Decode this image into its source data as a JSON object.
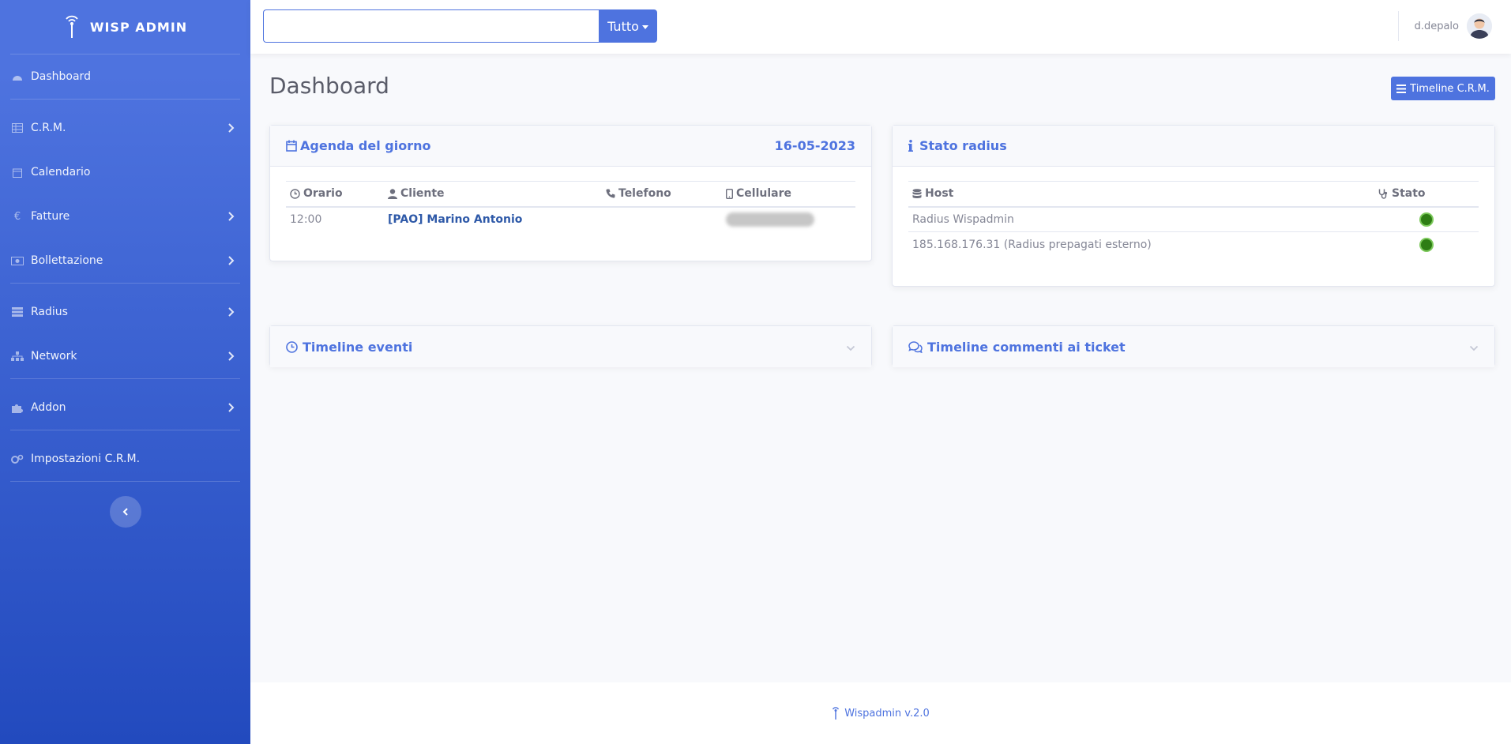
{
  "app": {
    "brand": "WISP ADMIN"
  },
  "sidebar": {
    "items": [
      {
        "label": "Dashboard"
      },
      {
        "label": "C.R.M."
      },
      {
        "label": "Calendario"
      },
      {
        "label": "Fatture"
      },
      {
        "label": "Bollettazione"
      },
      {
        "label": "Radius"
      },
      {
        "label": "Network"
      },
      {
        "label": "Addon"
      },
      {
        "label": "Impostazioni C.R.M."
      }
    ]
  },
  "topbar": {
    "search_value": "",
    "search_scope": "Tutto",
    "username": "d.depalo"
  },
  "page": {
    "title": "Dashboard",
    "timeline_button": "Timeline C.R.M."
  },
  "agenda": {
    "title": "Agenda del giorno",
    "date": "16-05-2023",
    "columns": [
      "Orario",
      "Cliente",
      "Telefono",
      "Cellulare"
    ],
    "rows": [
      {
        "orario": "12:00",
        "cliente": "[PAO] Marino Antonio",
        "telefono": ""
      }
    ]
  },
  "radius": {
    "title": "Stato radius",
    "columns": [
      "Host",
      "Stato"
    ],
    "rows": [
      {
        "host": "Radius Wispadmin",
        "status_color": "#2e7d14"
      },
      {
        "host": "185.168.176.31 (Radius prepagati esterno)",
        "status_color": "#2e7d14"
      }
    ]
  },
  "timeline_eventi": {
    "title": "Timeline eventi"
  },
  "timeline_ticket": {
    "title": "Timeline commenti ai ticket"
  },
  "footer": {
    "text": "Wispadmin v.2.0"
  },
  "colors": {
    "primary": "#4e73df",
    "sidebar_bottom": "#224abe",
    "status_ok": "#2e7d14"
  }
}
